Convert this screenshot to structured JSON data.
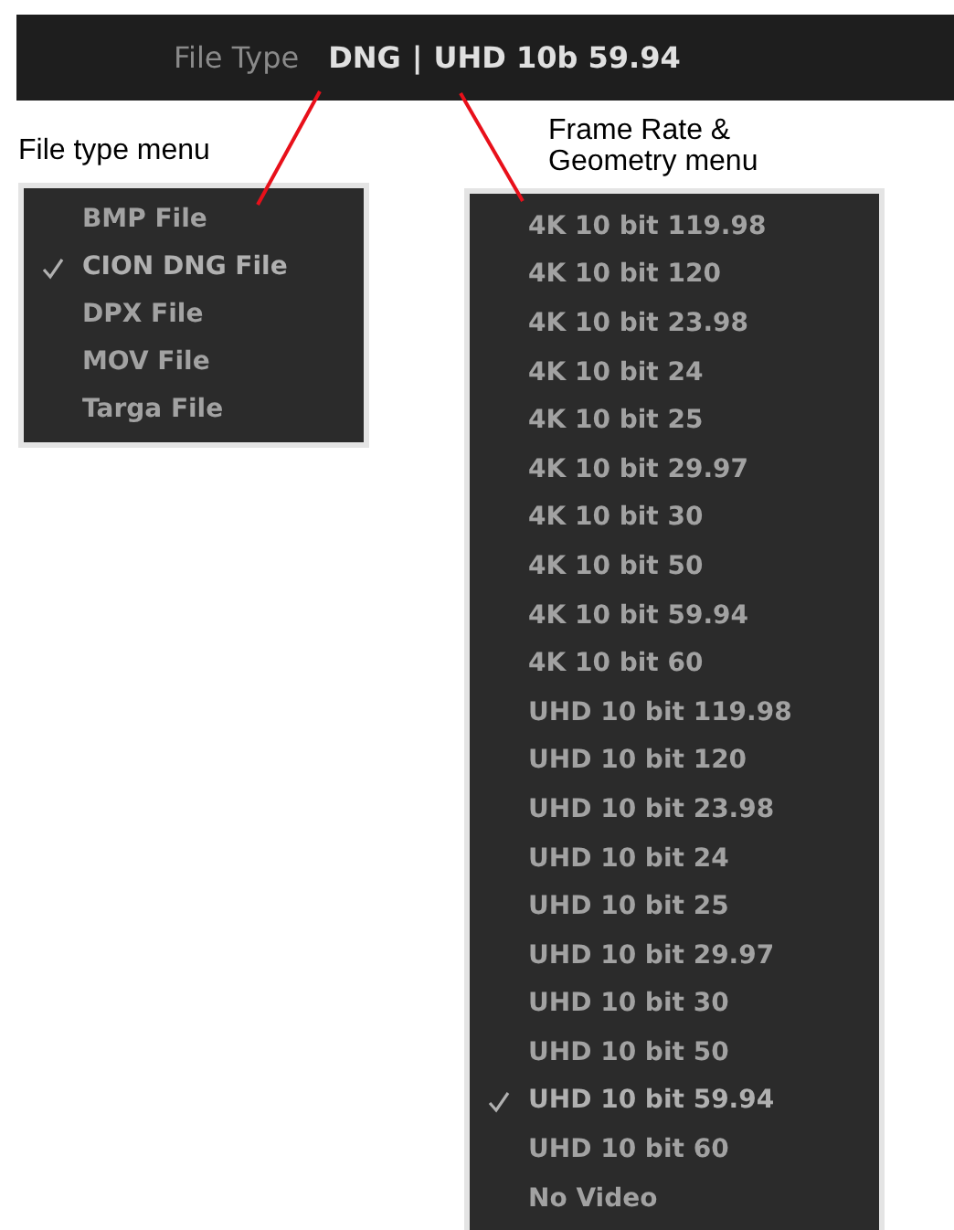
{
  "status_bar": {
    "label": "File Type",
    "file_type": "DNG",
    "separator": "|",
    "format": "UHD 10b 59.94"
  },
  "file_type_menu": {
    "caption": "File type menu",
    "items": [
      {
        "label": "BMP File",
        "selected": false
      },
      {
        "label": "CION DNG File",
        "selected": true
      },
      {
        "label": "DPX File",
        "selected": false
      },
      {
        "label": "MOV File",
        "selected": false
      },
      {
        "label": "Targa File",
        "selected": false
      }
    ]
  },
  "frame_rate_menu": {
    "caption": [
      "Frame Rate &",
      "Geometry menu"
    ],
    "items": [
      {
        "label": "4K 10 bit 119.98",
        "selected": false
      },
      {
        "label": "4K 10 bit 120",
        "selected": false
      },
      {
        "label": "4K 10 bit 23.98",
        "selected": false
      },
      {
        "label": "4K 10 bit 24",
        "selected": false
      },
      {
        "label": "4K 10 bit 25",
        "selected": false
      },
      {
        "label": "4K 10 bit 29.97",
        "selected": false
      },
      {
        "label": "4K 10 bit 30",
        "selected": false
      },
      {
        "label": "4K 10 bit 50",
        "selected": false
      },
      {
        "label": "4K 10 bit 59.94",
        "selected": false
      },
      {
        "label": "4K 10 bit 60",
        "selected": false
      },
      {
        "label": "UHD 10 bit 119.98",
        "selected": false
      },
      {
        "label": "UHD 10 bit 120",
        "selected": false
      },
      {
        "label": "UHD 10 bit 23.98",
        "selected": false
      },
      {
        "label": "UHD 10 bit 24",
        "selected": false
      },
      {
        "label": "UHD 10 bit 25",
        "selected": false
      },
      {
        "label": "UHD 10 bit 29.97",
        "selected": false
      },
      {
        "label": "UHD 10 bit 30",
        "selected": false
      },
      {
        "label": "UHD 10 bit 50",
        "selected": false
      },
      {
        "label": "UHD 10 bit 59.94",
        "selected": true
      },
      {
        "label": "UHD 10 bit 60",
        "selected": false
      },
      {
        "label": "No Video",
        "selected": false
      }
    ]
  }
}
